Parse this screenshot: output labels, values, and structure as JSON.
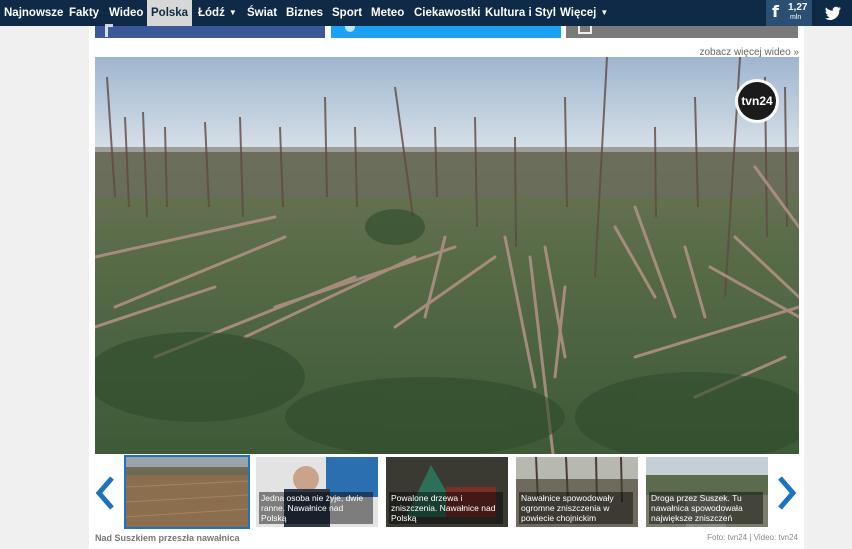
{
  "nav": {
    "items": [
      {
        "label": "Najnowsze",
        "active": false,
        "dropdown": false
      },
      {
        "label": "Fakty",
        "active": false,
        "dropdown": false
      },
      {
        "label": "Wideo",
        "active": false,
        "dropdown": false
      },
      {
        "label": "Polska",
        "active": true,
        "dropdown": false
      },
      {
        "label": "Łódź",
        "active": false,
        "dropdown": true
      },
      {
        "label": "Świat",
        "active": false,
        "dropdown": false
      },
      {
        "label": "Biznes",
        "active": false,
        "dropdown": false
      },
      {
        "label": "Sport",
        "active": false,
        "dropdown": false
      },
      {
        "label": "Meteo",
        "active": false,
        "dropdown": false
      },
      {
        "label": "Ciekawostki",
        "active": false,
        "dropdown": false
      },
      {
        "label": "Kultura i Styl",
        "active": false,
        "dropdown": false
      },
      {
        "label": "Więcej",
        "active": false,
        "dropdown": true
      }
    ],
    "facebook": {
      "icon": "facebook-icon",
      "count": "1,27",
      "unit": "mln"
    },
    "twitter": {
      "icon": "twitter-icon"
    }
  },
  "share_buttons": [
    {
      "name": "facebook-share-button",
      "color": "#3b5998",
      "icon": "facebook-icon"
    },
    {
      "name": "twitter-share-button",
      "color": "#1da1f2",
      "icon": "twitter-icon"
    },
    {
      "name": "email-share-button",
      "color": "#7a7a7a",
      "icon": "envelope-icon"
    }
  ],
  "gallery": {
    "see_more": "zobacz więcej wideo »",
    "logo_text": "tvn24",
    "caption": "Nad Suszkiem przeszła nawałnica",
    "credit": "Foto: tvn24 | Video: tvn24",
    "thumbs": [
      {
        "caption": "",
        "selected": true
      },
      {
        "caption": "Jedna osoba nie żyje, dwie ranne. Nawałnice nad Polską",
        "selected": false
      },
      {
        "caption": "Powalone drzewa i zniszczenia. Nawałnice nad Polską",
        "selected": false
      },
      {
        "caption": "Nawałnice spowodowały ogromne zniszczenia w powiecie chojnickim",
        "selected": false
      },
      {
        "caption": "Droga przez Suszek. Tu nawałnica spowodowała największe zniszczeń",
        "selected": false
      }
    ]
  },
  "colors": {
    "nav_bg": "#0e2a47",
    "accent": "#1e73be",
    "active_tab": "#d7d7d7"
  }
}
